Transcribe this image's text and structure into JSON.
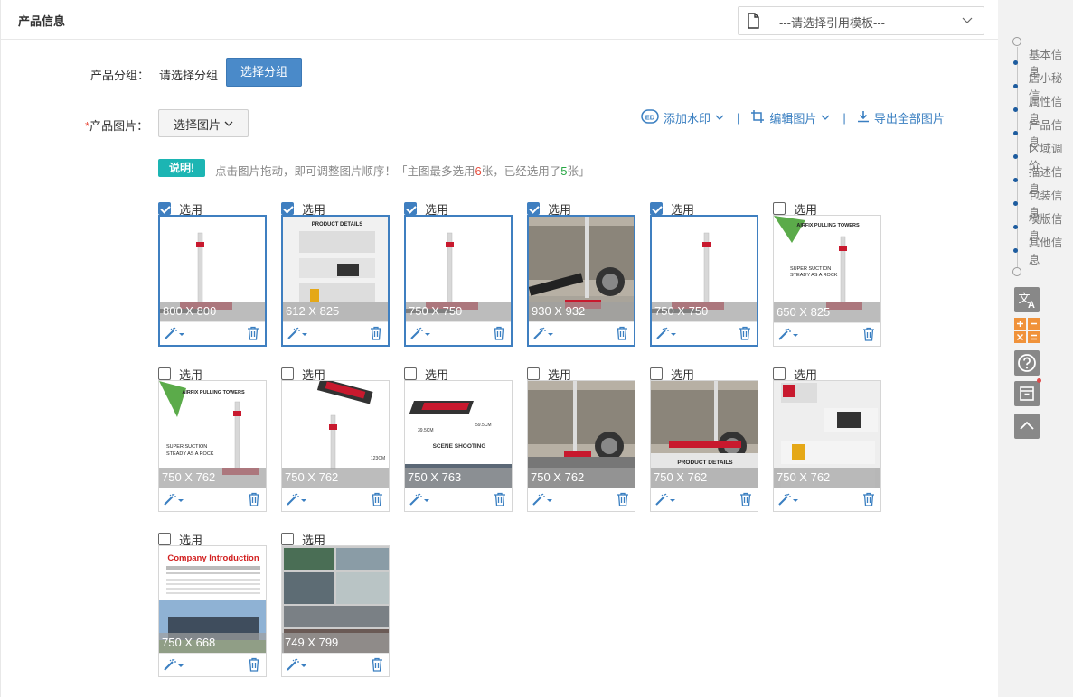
{
  "panel": {
    "title": "产品信息"
  },
  "template_select": {
    "value": "---请选择引用模板---"
  },
  "group_row": {
    "label": "产品分组：",
    "value": "请选择分组",
    "button": "选择分组"
  },
  "image_row": {
    "required_mark": "*",
    "label": "产品图片：",
    "select_button": "选择图片"
  },
  "tools": {
    "watermark": "添加水印",
    "edit_image": "编辑图片",
    "export_all": "导出全部图片"
  },
  "note": {
    "badge": "说明!",
    "text_a": "点击图片拖动，即可调整图片顺序！「主图最多选用",
    "max_count": "6",
    "text_b": "张，已经选用了",
    "used_count": "5",
    "text_c": "张」"
  },
  "select_label": "选用",
  "images": [
    {
      "dim": "800 X 800",
      "selected": true
    },
    {
      "dim": "612 X 825",
      "selected": true,
      "caption": "PRODUCT DETAILS"
    },
    {
      "dim": "750 X 750",
      "selected": true
    },
    {
      "dim": "930 X 932",
      "selected": true
    },
    {
      "dim": "750 X 750",
      "selected": true
    },
    {
      "dim": "650 X 825",
      "selected": false,
      "caption": "AIRFIX PULLING TOWERS",
      "caption2": "SUPER SUCTION STEADY AS A ROCK"
    },
    {
      "dim": "750 X 762",
      "selected": false,
      "caption": "AIRFIX PULLING TOWERS",
      "caption2": "SUPER SUCTION STEADY AS A ROCK"
    },
    {
      "dim": "750 X 762",
      "selected": false,
      "caption": "123CM"
    },
    {
      "dim": "750 X 763",
      "selected": false,
      "caption": "SCENE SHOOTING",
      "caption2": "39.5CM",
      "caption3": "59.5CM"
    },
    {
      "dim": "750 X 762",
      "selected": false
    },
    {
      "dim": "750 X 762",
      "selected": false,
      "caption": "PRODUCT DETAILS"
    },
    {
      "dim": "750 X 762",
      "selected": false
    },
    {
      "dim": "750 X 668",
      "selected": false,
      "caption": "Company Introduction"
    },
    {
      "dim": "749 X 799",
      "selected": false
    }
  ],
  "side_nav": [
    "基本信息",
    "店小秘信",
    "属性信息",
    "产品信息",
    "区域调价",
    "描述信息",
    "包装信息",
    "模版信息",
    "其他信息"
  ],
  "side_tools": [
    "translate-icon",
    "calculator-icon",
    "help-icon",
    "archive-icon",
    "back-to-top-icon"
  ]
}
